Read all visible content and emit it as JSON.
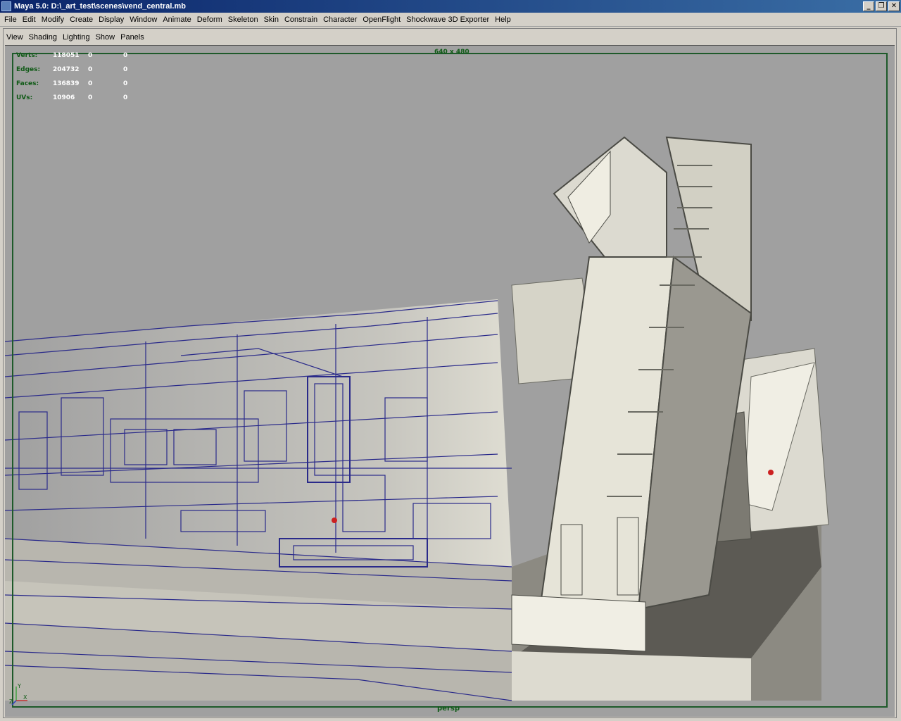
{
  "window": {
    "title": "Maya 5.0: D:\\_art_test\\scenes\\vend_central.mb",
    "min_label": "_",
    "restore_label": "❐",
    "close_label": "✕"
  },
  "menu": {
    "items": [
      "File",
      "Edit",
      "Modify",
      "Create",
      "Display",
      "Window",
      "Animate",
      "Deform",
      "Skeleton",
      "Skin",
      "Constrain",
      "Character",
      "OpenFlight",
      "Shockwave 3D Exporter",
      "Help"
    ]
  },
  "panel_menu": {
    "items": [
      "View",
      "Shading",
      "Lighting",
      "Show",
      "Panels"
    ]
  },
  "hud": {
    "rows": [
      {
        "label": "Verts:",
        "value": "118051",
        "c1": "0",
        "c2": "0"
      },
      {
        "label": "Edges:",
        "value": "204732",
        "c1": "0",
        "c2": "0"
      },
      {
        "label": "Faces:",
        "value": "136839",
        "c1": "0",
        "c2": "0"
      },
      {
        "label": "UVs:",
        "value": "10906",
        "c1": "0",
        "c2": "0"
      }
    ],
    "resolution": "640 x 480",
    "camera": "persp"
  },
  "axis": {
    "x": "X",
    "y": "Y",
    "z": "Z"
  },
  "colors": {
    "viewport_bg": "#a0a0a0",
    "wireframe": "#2a2a8a",
    "hud_green": "#0f5a16",
    "model_light": "#e6e4d8",
    "model_dark": "#6a6a62",
    "locator_red": "#cc2020"
  }
}
